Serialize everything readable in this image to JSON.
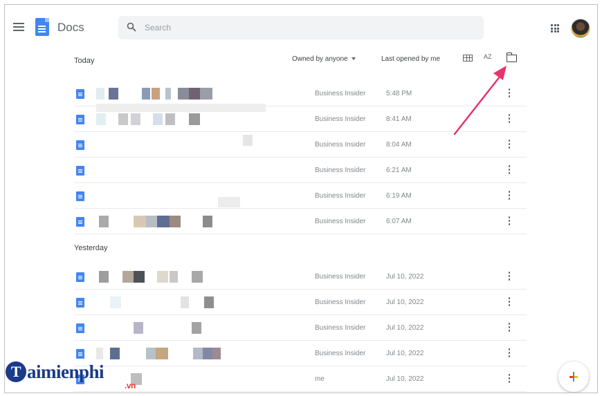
{
  "header": {
    "app_title": "Docs",
    "search_placeholder": "Search"
  },
  "list_header": {
    "owned_by": "Owned by anyone",
    "last_opened": "Last opened by me",
    "sort_label": "AZ"
  },
  "sections": {
    "today": "Today",
    "yesterday": "Yesterday"
  },
  "today_rows": [
    {
      "owner": "Business Insider",
      "time": "5:48 PM"
    },
    {
      "owner": "Business Insider",
      "time": "8:41 AM"
    },
    {
      "owner": "Business Insider",
      "time": "8:04 AM"
    },
    {
      "owner": "Business Insider",
      "time": "6:21 AM"
    },
    {
      "owner": "Business Insider",
      "time": "6:19 AM"
    },
    {
      "owner": "Business Insider",
      "time": "6:07 AM"
    }
  ],
  "yesterday_rows": [
    {
      "owner": "Business Insider",
      "time": "Jul 10, 2022"
    },
    {
      "owner": "Business Insider",
      "time": "Jul 10, 2022"
    },
    {
      "owner": "Business Insider",
      "time": "Jul 10, 2022"
    },
    {
      "owner": "Business Insider",
      "time": "Jul 10, 2022"
    },
    {
      "owner": "me",
      "time": "Jul 10, 2022"
    }
  ],
  "watermark": {
    "logo_letter": "T",
    "main": "aimienphi",
    "suffix": ".vn"
  },
  "colors": {
    "accent": "#4285f4",
    "arrow": "#e8336b"
  }
}
